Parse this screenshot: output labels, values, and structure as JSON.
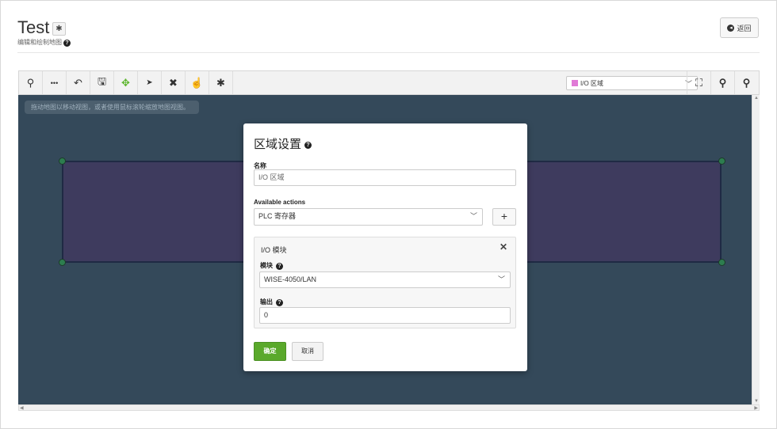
{
  "page": {
    "title": "Test",
    "subtitle": "编辑和绘制地图",
    "back_label": "返回"
  },
  "toolbar": {
    "tools": [
      {
        "name": "search-icon",
        "glyph": "⚲"
      },
      {
        "name": "more-icon",
        "glyph": "•••"
      },
      {
        "name": "undo-icon",
        "glyph": "↶"
      },
      {
        "name": "save-icon",
        "glyph": "🖫"
      },
      {
        "name": "move-icon",
        "glyph": "✥"
      },
      {
        "name": "pointer-icon",
        "glyph": "➤"
      },
      {
        "name": "delete-icon",
        "glyph": "✖"
      },
      {
        "name": "select-add-icon",
        "glyph": "☝"
      },
      {
        "name": "gear-icon",
        "glyph": "✱"
      }
    ],
    "layer_select_value": "I/O 区域",
    "right_tools": [
      {
        "name": "fit-screen-icon",
        "glyph": "⛶"
      },
      {
        "name": "zoom-in-icon",
        "glyph": "⚲"
      },
      {
        "name": "zoom-out-icon",
        "glyph": "⚲"
      }
    ]
  },
  "canvas": {
    "hint": "拖动地图以移动视图，或者使用鼠标滚轮缩放地图视图。"
  },
  "dialog": {
    "title": "区域设置",
    "name_label": "名称",
    "name_value": "I/O 区域",
    "actions_label": "Available actions",
    "actions_value": "PLC 寄存器",
    "add_label": "+",
    "panel": {
      "title": "I/O 模块",
      "close": "✕",
      "module_label": "模块",
      "module_value": "WISE-4050/LAN",
      "output_label": "输出",
      "output_value": "0"
    },
    "ok_label": "确定",
    "cancel_label": "取消"
  },
  "colors": {
    "canvas_bg": "#34495a",
    "zone_fill": "#3e3b5e",
    "zone_handle": "#2d7d4f",
    "primary_button": "#5aa92b",
    "layer_swatch": "#e07ad6"
  }
}
